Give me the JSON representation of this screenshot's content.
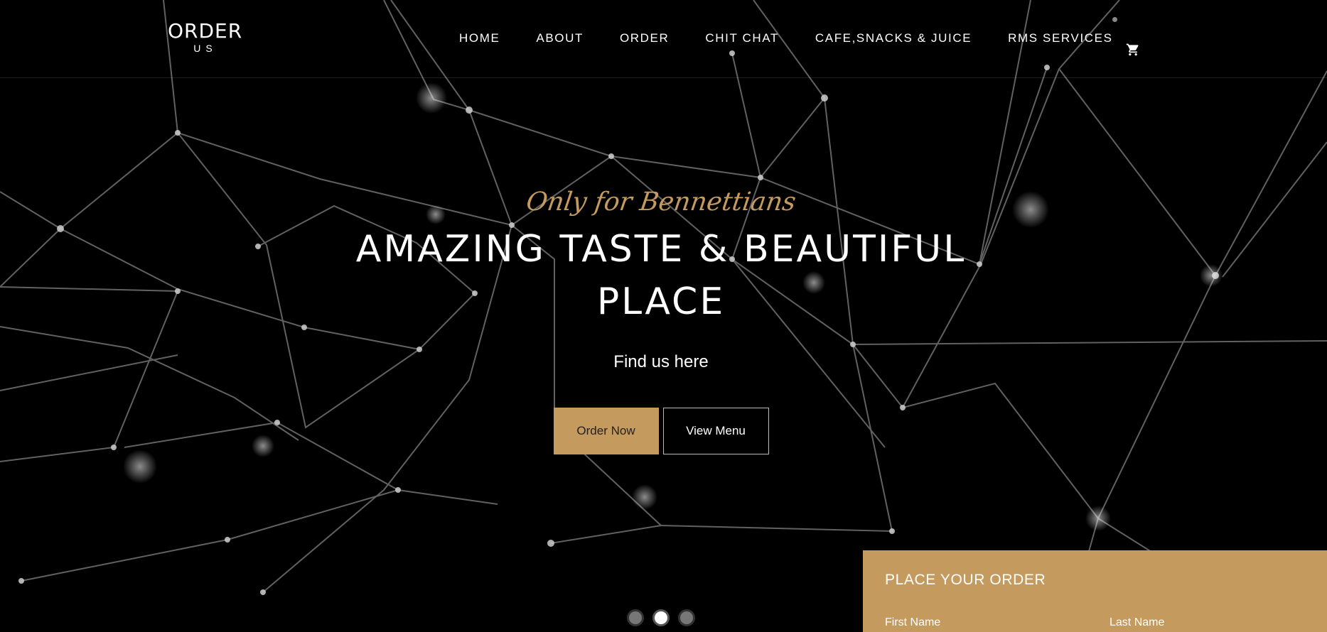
{
  "brand": {
    "logo_main": "ORDER",
    "logo_sub": "US"
  },
  "nav": {
    "items": [
      {
        "label": "HOME"
      },
      {
        "label": "ABOUT"
      },
      {
        "label": "ORDER"
      },
      {
        "label": "CHIT CHAT"
      },
      {
        "label": "CAFE,SNACKS & JUICE"
      },
      {
        "label": "RMS SERVICES"
      }
    ],
    "cart_icon": "shopping-cart-icon"
  },
  "hero": {
    "tagline": "Only for Bennettians",
    "headline": "AMAZING TASTE & BEAUTIFUL PLACE",
    "subtext": "Find us here",
    "primary_button": "Order Now",
    "secondary_button": "View Menu"
  },
  "slider": {
    "dots": 3,
    "active_index": 1
  },
  "order_form": {
    "title": "PLACE YOUR ORDER",
    "first_name_label": "First Name",
    "last_name_label": "Last Name"
  },
  "colors": {
    "accent": "#c49a5e",
    "background": "#000000",
    "text": "#ffffff"
  }
}
